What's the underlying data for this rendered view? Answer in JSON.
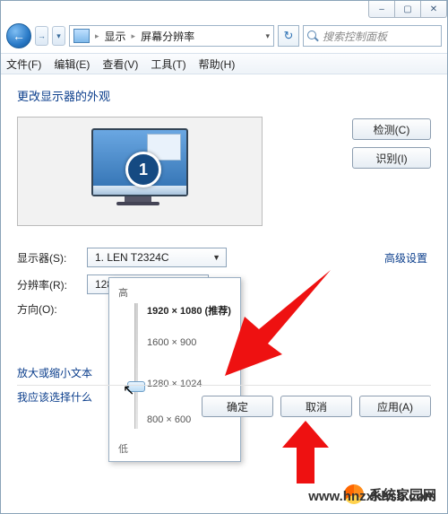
{
  "caption_buttons": {
    "min": "–",
    "max": "▢",
    "close": "✕"
  },
  "nav": {
    "back": "←",
    "fwd": "→",
    "history": "▾",
    "root": "显示",
    "current": "屏幕分辨率",
    "dd": "▾",
    "refresh": "↻"
  },
  "search": {
    "placeholder": "搜索控制面板"
  },
  "menu": {
    "file": "文件(F)",
    "edit": "编辑(E)",
    "view": "查看(V)",
    "tools": "工具(T)",
    "help": "帮助(H)"
  },
  "heading": "更改显示器的外观",
  "side": {
    "detect": "检测(C)",
    "identify": "识别(I)"
  },
  "monitor_number": "1",
  "labels": {
    "display": "显示器(S):",
    "resolution": "分辨率(R):",
    "orientation": "方向(O):"
  },
  "values": {
    "display": "1. LEN T2324C",
    "resolution": "1280 × 1024"
  },
  "advanced": "高级设置",
  "links": {
    "textsize": "放大或缩小文本",
    "which": "我应该选择什么"
  },
  "popup": {
    "high": "高",
    "low": "低",
    "opts": [
      "1920 × 1080 (推荐)",
      "1600 × 900",
      "1280 × 1024",
      "800 × 600"
    ]
  },
  "buttons": {
    "ok": "确定",
    "cancel": "取消",
    "apply": "应用(A)"
  },
  "watermark": {
    "brand": "系统家园网",
    "url": "www.hnzxkhsb.com"
  }
}
